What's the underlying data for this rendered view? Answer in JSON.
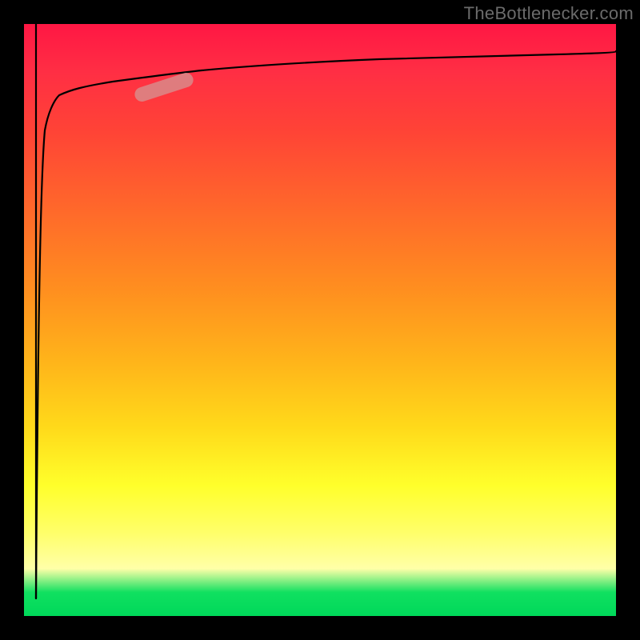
{
  "watermark": "TheBottlenecker.com",
  "chart_data": {
    "type": "line",
    "title": "",
    "xlabel": "",
    "ylabel": "",
    "xlim": [
      0,
      100
    ],
    "ylim": [
      0,
      100
    ],
    "grid": false,
    "legend": false,
    "background_gradient": {
      "direction": "vertical",
      "stops": [
        {
          "pct": 0,
          "color": "#ff1744"
        },
        {
          "pct": 45,
          "color": "#ff8f1f"
        },
        {
          "pct": 78,
          "color": "#ffff2b"
        },
        {
          "pct": 92,
          "color": "#ffffa8"
        },
        {
          "pct": 100,
          "color": "#00d85a"
        }
      ]
    },
    "series": [
      {
        "name": "curve",
        "color": "#000000",
        "stroke_width": 2,
        "x": [
          2.0,
          2.5,
          3.0,
          3.5,
          4.0,
          5.0,
          6.0,
          8.0,
          10,
          15,
          20,
          25,
          30,
          40,
          50,
          60,
          70,
          80,
          90,
          100
        ],
        "y": [
          3.0,
          60,
          76,
          82,
          85,
          87,
          88,
          89,
          89.5,
          90.3,
          91.0,
          91.6,
          92.1,
          93.0,
          93.6,
          94.1,
          94.5,
          94.8,
          95.1,
          95.4
        ]
      },
      {
        "name": "initial-drop",
        "color": "#000000",
        "stroke_width": 2,
        "x": [
          2.0,
          2.0
        ],
        "y": [
          100,
          3.0
        ]
      }
    ],
    "markers": [
      {
        "name": "highlight-segment",
        "shape": "rounded-bar",
        "color": "#d98a8a",
        "opacity": 0.85,
        "x_range": [
          20,
          28
        ],
        "y_range": [
          87,
          90
        ],
        "angle_deg": -28
      }
    ]
  }
}
